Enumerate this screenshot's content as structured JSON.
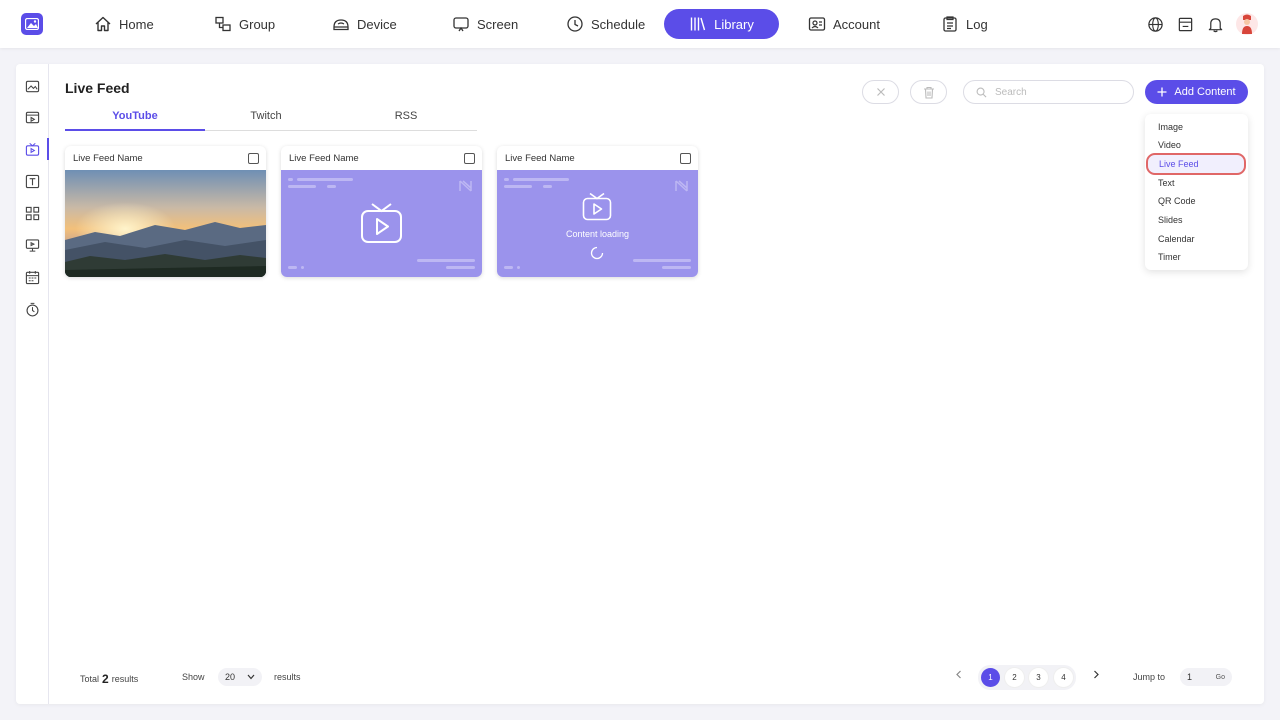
{
  "nav": {
    "items": [
      {
        "label": "Home",
        "icon": "home-icon"
      },
      {
        "label": "Group",
        "icon": "group-icon"
      },
      {
        "label": "Device",
        "icon": "device-icon"
      },
      {
        "label": "Screen",
        "icon": "screen-icon"
      },
      {
        "label": "Schedule",
        "icon": "clock-icon"
      },
      {
        "label": "Library",
        "icon": "library-icon",
        "active": true
      },
      {
        "label": "Account",
        "icon": "account-icon"
      },
      {
        "label": "Log",
        "icon": "log-icon"
      }
    ],
    "right_icons": [
      "globe-icon",
      "store-icon",
      "bell-icon",
      "avatar"
    ]
  },
  "colors": {
    "accent": "#5b4de8",
    "card_purple": "#9b93ec",
    "highlight": "#e06767"
  },
  "sidebar": {
    "items": [
      "image-icon",
      "video-icon",
      "live-feed-icon",
      "text-icon",
      "qr-code-icon",
      "slides-icon",
      "calendar-icon",
      "timer-icon"
    ],
    "active_index": 2
  },
  "page": {
    "title": "Live Feed",
    "tabs": [
      {
        "label": "YouTube",
        "active": true
      },
      {
        "label": "Twitch"
      },
      {
        "label": "RSS"
      }
    ]
  },
  "toolbar": {
    "search_placeholder": "Search",
    "add_label": "Add Content"
  },
  "dropdown": {
    "items": [
      {
        "label": "Image"
      },
      {
        "label": "Video"
      },
      {
        "label": "Live Feed",
        "selected": true
      },
      {
        "label": "Text"
      },
      {
        "label": "QR Code"
      },
      {
        "label": "Slides"
      },
      {
        "label": "Calendar"
      },
      {
        "label": "Timer"
      }
    ]
  },
  "cards": [
    {
      "name": "Live Feed Name",
      "state": "image"
    },
    {
      "name": "Live Feed Name",
      "state": "placeholder"
    },
    {
      "name": "Live Feed Name",
      "state": "loading",
      "loading_text": "Content loading"
    }
  ],
  "footer": {
    "total_prefix": "Total",
    "total_count": "2",
    "total_suffix": "results",
    "show_label": "Show",
    "page_size": "20",
    "show_suffix": "results",
    "pages": [
      "1",
      "2",
      "3",
      "4"
    ],
    "current_page": "1",
    "jump_label": "Jump to",
    "jump_value": "1",
    "go_label": "Go"
  }
}
